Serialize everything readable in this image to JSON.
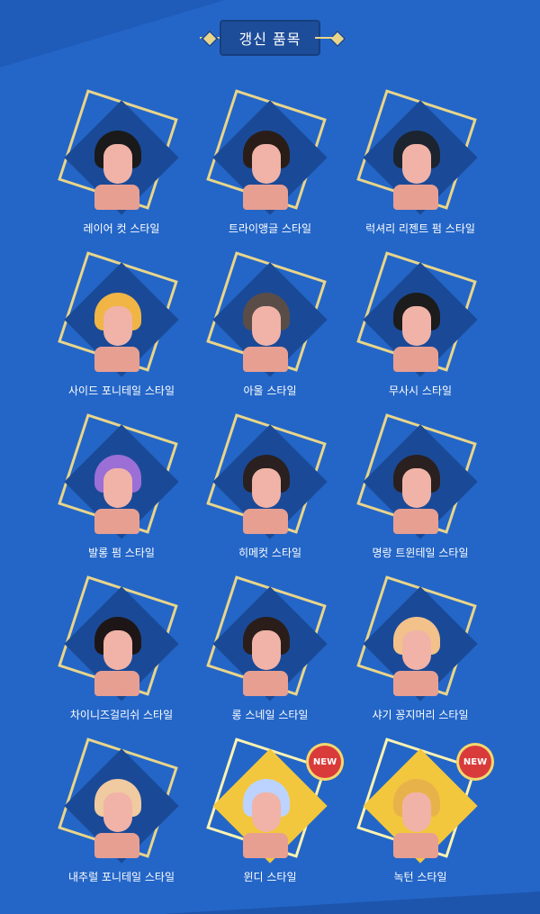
{
  "header": {
    "title": "갱신 품목"
  },
  "colors": {
    "background": "#2466c7",
    "accent": "#e9d58a",
    "new_badge": "#d93b3b"
  },
  "items": [
    {
      "label": "레이어 컷 스타일",
      "hair": "#1a1a1a",
      "new": false
    },
    {
      "label": "트라이앵글 스타일",
      "hair": "#2a1d18",
      "new": false
    },
    {
      "label": "럭셔리 리젠트 펌 스타일",
      "hair": "#1c2430",
      "new": false
    },
    {
      "label": "사이드 포니테일 스타일",
      "hair": "#f0b545",
      "new": false
    },
    {
      "label": "아울 스타일",
      "hair": "#5a4d48",
      "new": false
    },
    {
      "label": "무사시 스타일",
      "hair": "#1c1c1c",
      "new": false
    },
    {
      "label": "발롱 펌 스타일",
      "hair": "#9b6fd6",
      "new": false
    },
    {
      "label": "히메컷 스타일",
      "hair": "#2a2020",
      "new": false
    },
    {
      "label": "명랑 트윈테일 스타일",
      "hair": "#2a2020",
      "new": false
    },
    {
      "label": "차이니즈걸리쉬 스타일",
      "hair": "#1e1616",
      "new": false
    },
    {
      "label": "롱 스네일 스타일",
      "hair": "#2b1e1a",
      "new": false
    },
    {
      "label": "샤기 꽁지머리 스타일",
      "hair": "#f2c28a",
      "new": false
    },
    {
      "label": "내추럴 포니테일 스타일",
      "hair": "#f0caa0",
      "new": false
    },
    {
      "label": "윈디 스타일",
      "hair": "#bcd3ff",
      "new": true,
      "badge": "NEW"
    },
    {
      "label": "녹턴 스타일",
      "hair": "#e8b24a",
      "new": true,
      "badge": "NEW"
    }
  ]
}
